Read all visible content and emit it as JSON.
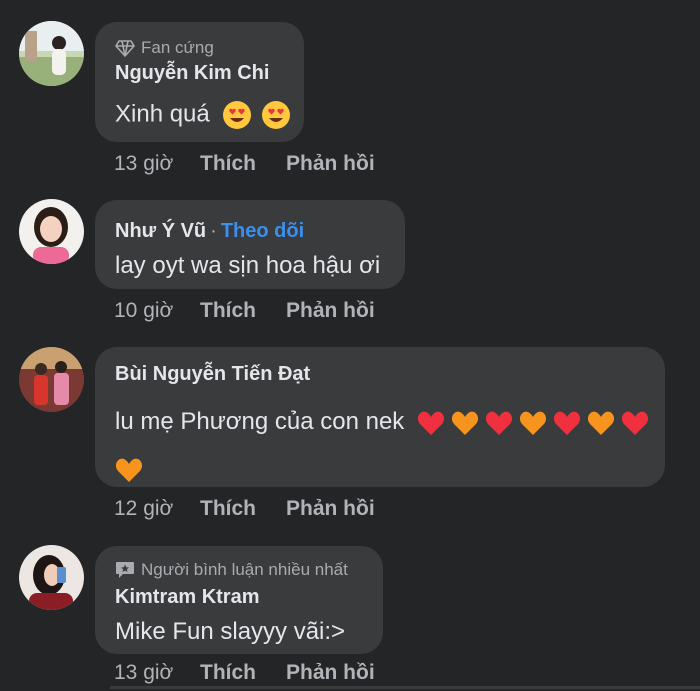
{
  "comments": [
    {
      "badge": "Fan cứng",
      "badge_icon": "diamond-icon",
      "author": "Nguyễn Kim Chi",
      "text": "Xinh quá",
      "emojis": [
        "heart-eyes-emoji",
        "heart-eyes-emoji"
      ],
      "time": "13 giờ",
      "like": "Thích",
      "reply": "Phản hồi"
    },
    {
      "author": "Như Ý Vũ",
      "separator": "·",
      "follow": "Theo dõi",
      "text": "lay oyt wa sịn hoa hậu ơi",
      "time": "10 giờ",
      "like": "Thích",
      "reply": "Phản hồi"
    },
    {
      "author": "Bùi Nguyễn Tiến Đạt",
      "text": "lu mẹ Phương của con nek",
      "emojis": [
        "red-heart-emoji",
        "orange-heart-emoji",
        "red-heart-emoji",
        "orange-heart-emoji",
        "red-heart-emoji",
        "orange-heart-emoji",
        "red-heart-emoji",
        "orange-heart-emoji"
      ],
      "time": "12 giờ",
      "like": "Thích",
      "reply": "Phản hồi"
    },
    {
      "badge": "Người bình luận nhiều nhất",
      "badge_icon": "comment-bubble-icon",
      "author": "Kimtram Ktram",
      "text": "Mike Fun slayyy vãi:>",
      "time": "13 giờ",
      "like": "Thích",
      "reply": "Phản hồi"
    }
  ],
  "colors": {
    "background": "#242526",
    "bubble": "#3a3b3c",
    "link_blue": "#3a8ff0",
    "meta_text": "#b0b3b8",
    "red_heart": "#f0303e",
    "orange_heart": "#f7941d"
  }
}
